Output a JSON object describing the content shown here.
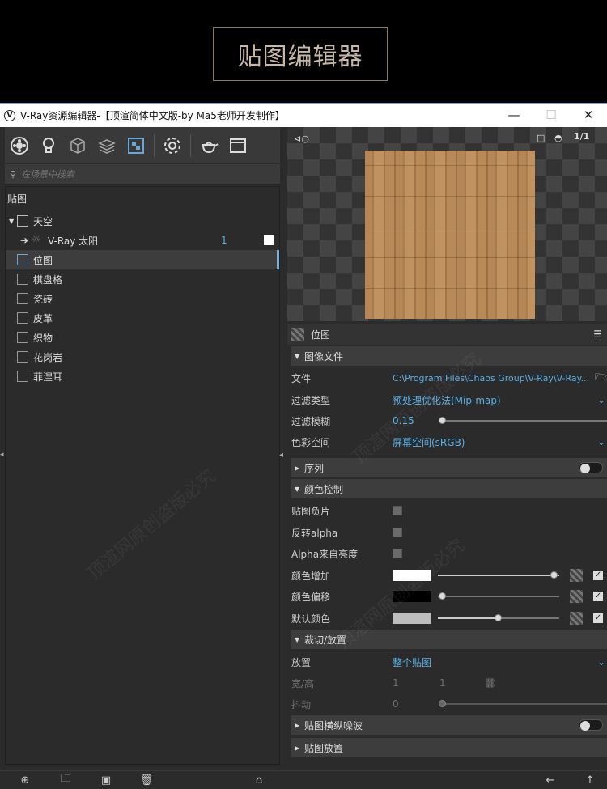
{
  "banner": {
    "title": "贴图编辑器"
  },
  "window": {
    "title": "V-Ray资源编辑器-【顶渲简体中文版-by Ma5老师开发制作】",
    "minimize": "—",
    "maximize": "☐",
    "close": "✕"
  },
  "toolbar": {
    "icons": [
      "materials-icon",
      "lights-icon",
      "geometry-icon",
      "render-elements-icon",
      "textures-icon",
      "settings-icon",
      "render-teapot-icon",
      "frame-buffer-icon"
    ]
  },
  "search": {
    "placeholder": "在场景中搜索"
  },
  "tree": {
    "header": "贴图",
    "items": [
      {
        "label": "天空",
        "icon": "sky-icon"
      },
      {
        "label": "V-Ray 太阳",
        "count": "1",
        "icon": "sun-icon"
      },
      {
        "label": "位图",
        "icon": "bitmap-icon",
        "selected": true
      },
      {
        "label": "棋盘格",
        "icon": "texture-icon"
      },
      {
        "label": "瓷砖",
        "icon": "texture-icon"
      },
      {
        "label": "皮革",
        "icon": "texture-icon"
      },
      {
        "label": "织物",
        "icon": "texture-icon"
      },
      {
        "label": "花岗岩",
        "icon": "texture-icon"
      },
      {
        "label": "菲涅耳",
        "icon": "texture-icon"
      }
    ]
  },
  "preview": {
    "page": "1",
    "pages": "1"
  },
  "panel": {
    "title": "位图",
    "image_file": {
      "header": "图像文件",
      "file_label": "文件",
      "file_value": "C:\\Program Files\\Chaos Group\\V-Ray\\V-Ray...",
      "filter_type_label": "过滤类型",
      "filter_type_value": "预处理优化法(Mip-map)",
      "filter_blur_label": "过滤模糊",
      "filter_blur_value": "0.15",
      "color_space_label": "色彩空间",
      "color_space_value": "屏幕空间(sRGB)"
    },
    "sequence": {
      "header": "序列"
    },
    "color_control": {
      "header": "颜色控制",
      "invert_label": "贴图负片",
      "invert_alpha_label": "反转alpha",
      "alpha_from_luma_label": "Alpha来自亮度",
      "color_mult_label": "颜色增加",
      "color_mult_color": "#ffffff",
      "color_mult_level": 1.0,
      "color_offset_label": "颜色偏移",
      "color_offset_color": "#000000",
      "color_offset_level": 0.0,
      "default_color_label": "默认颜色",
      "default_color_color": "#bdbdbd",
      "default_color_level": 0.5
    },
    "crop_place": {
      "header": "裁切/放置",
      "place_label": "放置",
      "place_value": "整个贴图",
      "wh_label": "宽/高",
      "w_value": "1",
      "h_value": "1",
      "jitter_label": "抖动",
      "jitter_value": "0"
    },
    "noise": {
      "header": "贴图横纵噪波"
    },
    "placement": {
      "header": "贴图放置"
    }
  },
  "watermark": "顶渲网原创盗版必究"
}
